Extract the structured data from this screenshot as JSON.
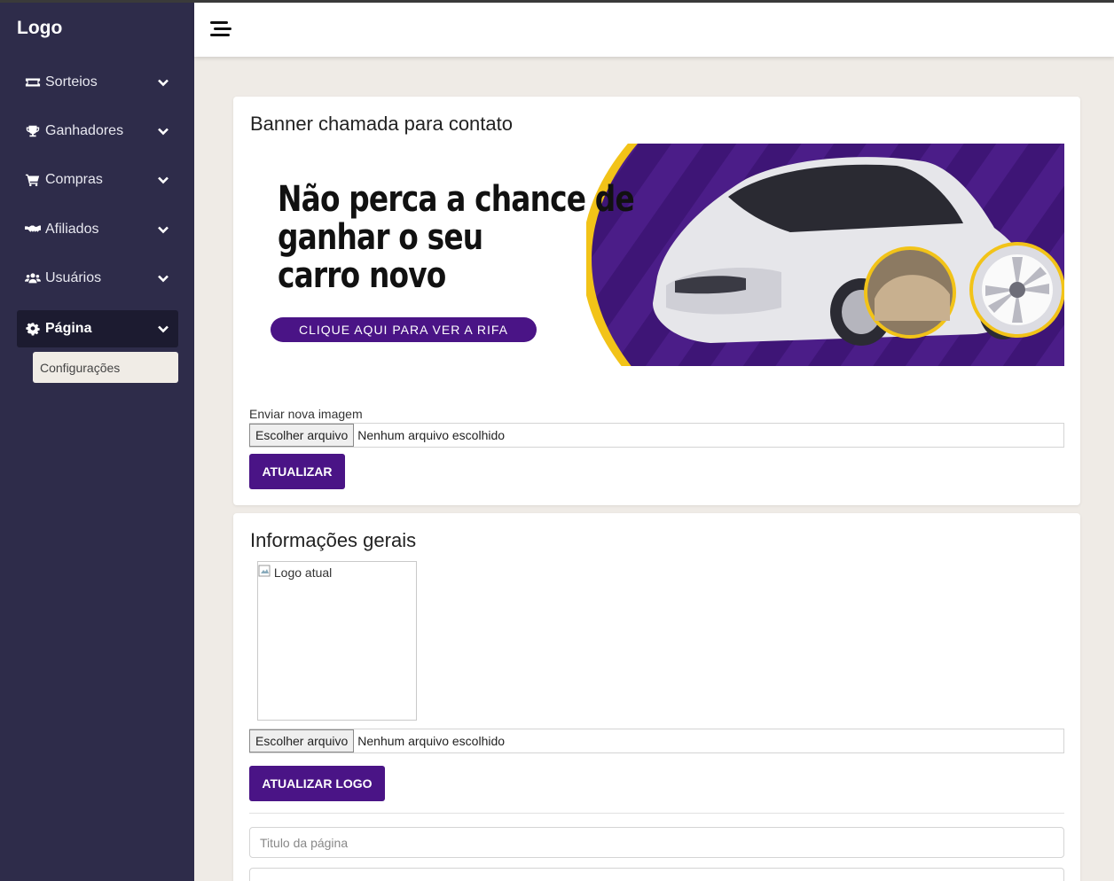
{
  "sidebar": {
    "logo": "Logo",
    "items": [
      {
        "label": "Sorteios",
        "icon": "ticket-icon"
      },
      {
        "label": "Ganhadores",
        "icon": "trophy-icon"
      },
      {
        "label": "Compras",
        "icon": "cart-icon"
      },
      {
        "label": "Afiliados",
        "icon": "handshake-icon"
      },
      {
        "label": "Usuários",
        "icon": "users-icon"
      },
      {
        "label": "Página",
        "icon": "gear-icon",
        "active": true
      }
    ],
    "subitem": "Configurações"
  },
  "banner_card": {
    "title": "Banner chamada para contato",
    "banner": {
      "headline_1": "Não perca a chance de",
      "headline_2": "ganhar o seu",
      "headline_3": "carro novo",
      "cta": "CLIQUE AQUI PARA VER A RIFA",
      "accent_color": "#4a1486",
      "ring_color": "#f2c318"
    },
    "upload_label": "Enviar nova imagem",
    "file_button": "Escolher arquivo",
    "file_status": "Nenhum arquivo escolhido",
    "submit": "ATUALIZAR"
  },
  "info_card": {
    "title": "Informações gerais",
    "logo_alt": "Logo atual",
    "file_button": "Escolher arquivo",
    "file_status": "Nenhum arquivo escolhido",
    "submit": "ATUALIZAR LOGO",
    "title_placeholder": "Titulo da página"
  },
  "colors": {
    "sidebar_bg": "#2e2c4a",
    "primary": "#4a1486",
    "page_bg": "#efebe6"
  }
}
